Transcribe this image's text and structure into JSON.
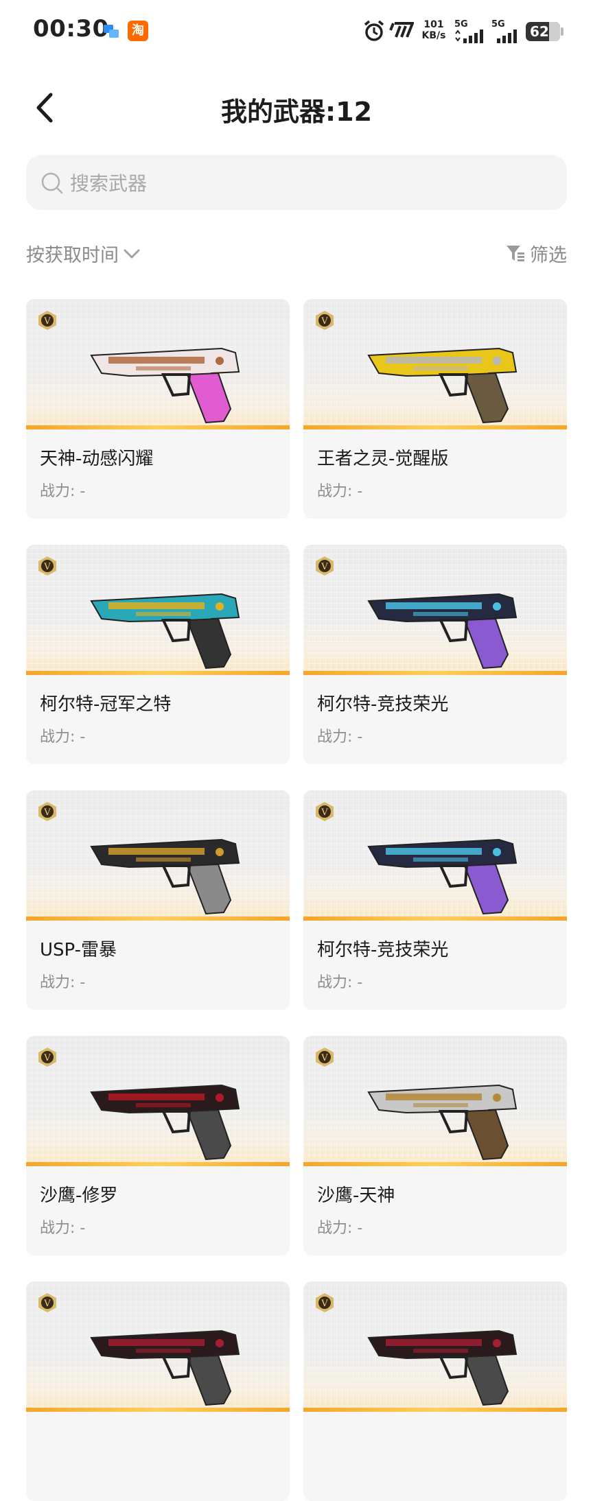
{
  "status_bar": {
    "time": "00:30",
    "notif_app": "淘",
    "speed_value": "101",
    "speed_unit": "KB/s",
    "net1": "5G",
    "net2": "5G",
    "battery": "62"
  },
  "header": {
    "title": "我的武器:12"
  },
  "search": {
    "placeholder": "搜索武器"
  },
  "toolbar": {
    "sort_label": "按获取时间",
    "filter_label": "筛选"
  },
  "badge_letter": "V",
  "weapons": [
    {
      "name": "天神-动感闪耀",
      "power": "战力: -",
      "colors": [
        "#f0e6e6",
        "#b06a40",
        "#e05cd0"
      ]
    },
    {
      "name": "王者之灵-觉醒版",
      "power": "战力: -",
      "colors": [
        "#e8c61a",
        "#b8b8b8",
        "#6a5a40"
      ]
    },
    {
      "name": "柯尔特-冠军之特",
      "power": "战力: -",
      "colors": [
        "#2aa8b8",
        "#e0b020",
        "#333333"
      ]
    },
    {
      "name": "柯尔特-竞技荣光",
      "power": "战力: -",
      "colors": [
        "#262a40",
        "#4ac0e0",
        "#8a5ad0"
      ]
    },
    {
      "name": "USP-雷暴",
      "power": "战力: -",
      "colors": [
        "#2a2a2a",
        "#d09a30",
        "#8a8a8a"
      ]
    },
    {
      "name": "柯尔特-竞技荣光",
      "power": "战力: -",
      "colors": [
        "#262a40",
        "#4ac0e0",
        "#8a5ad0"
      ]
    },
    {
      "name": "沙鹰-修罗",
      "power": "战力: -",
      "colors": [
        "#2a1a1c",
        "#b01a22",
        "#4a4a4a"
      ]
    },
    {
      "name": "沙鹰-天神",
      "power": "战力: -",
      "colors": [
        "#c8c8c8",
        "#b48a3a",
        "#6a5030"
      ]
    },
    {
      "name": "",
      "power": "",
      "colors": [
        "#2a1a1c",
        "#a02030",
        "#4a4a4a"
      ]
    },
    {
      "name": "",
      "power": "",
      "colors": [
        "#2a1a1c",
        "#a02030",
        "#4a4a4a"
      ]
    }
  ]
}
